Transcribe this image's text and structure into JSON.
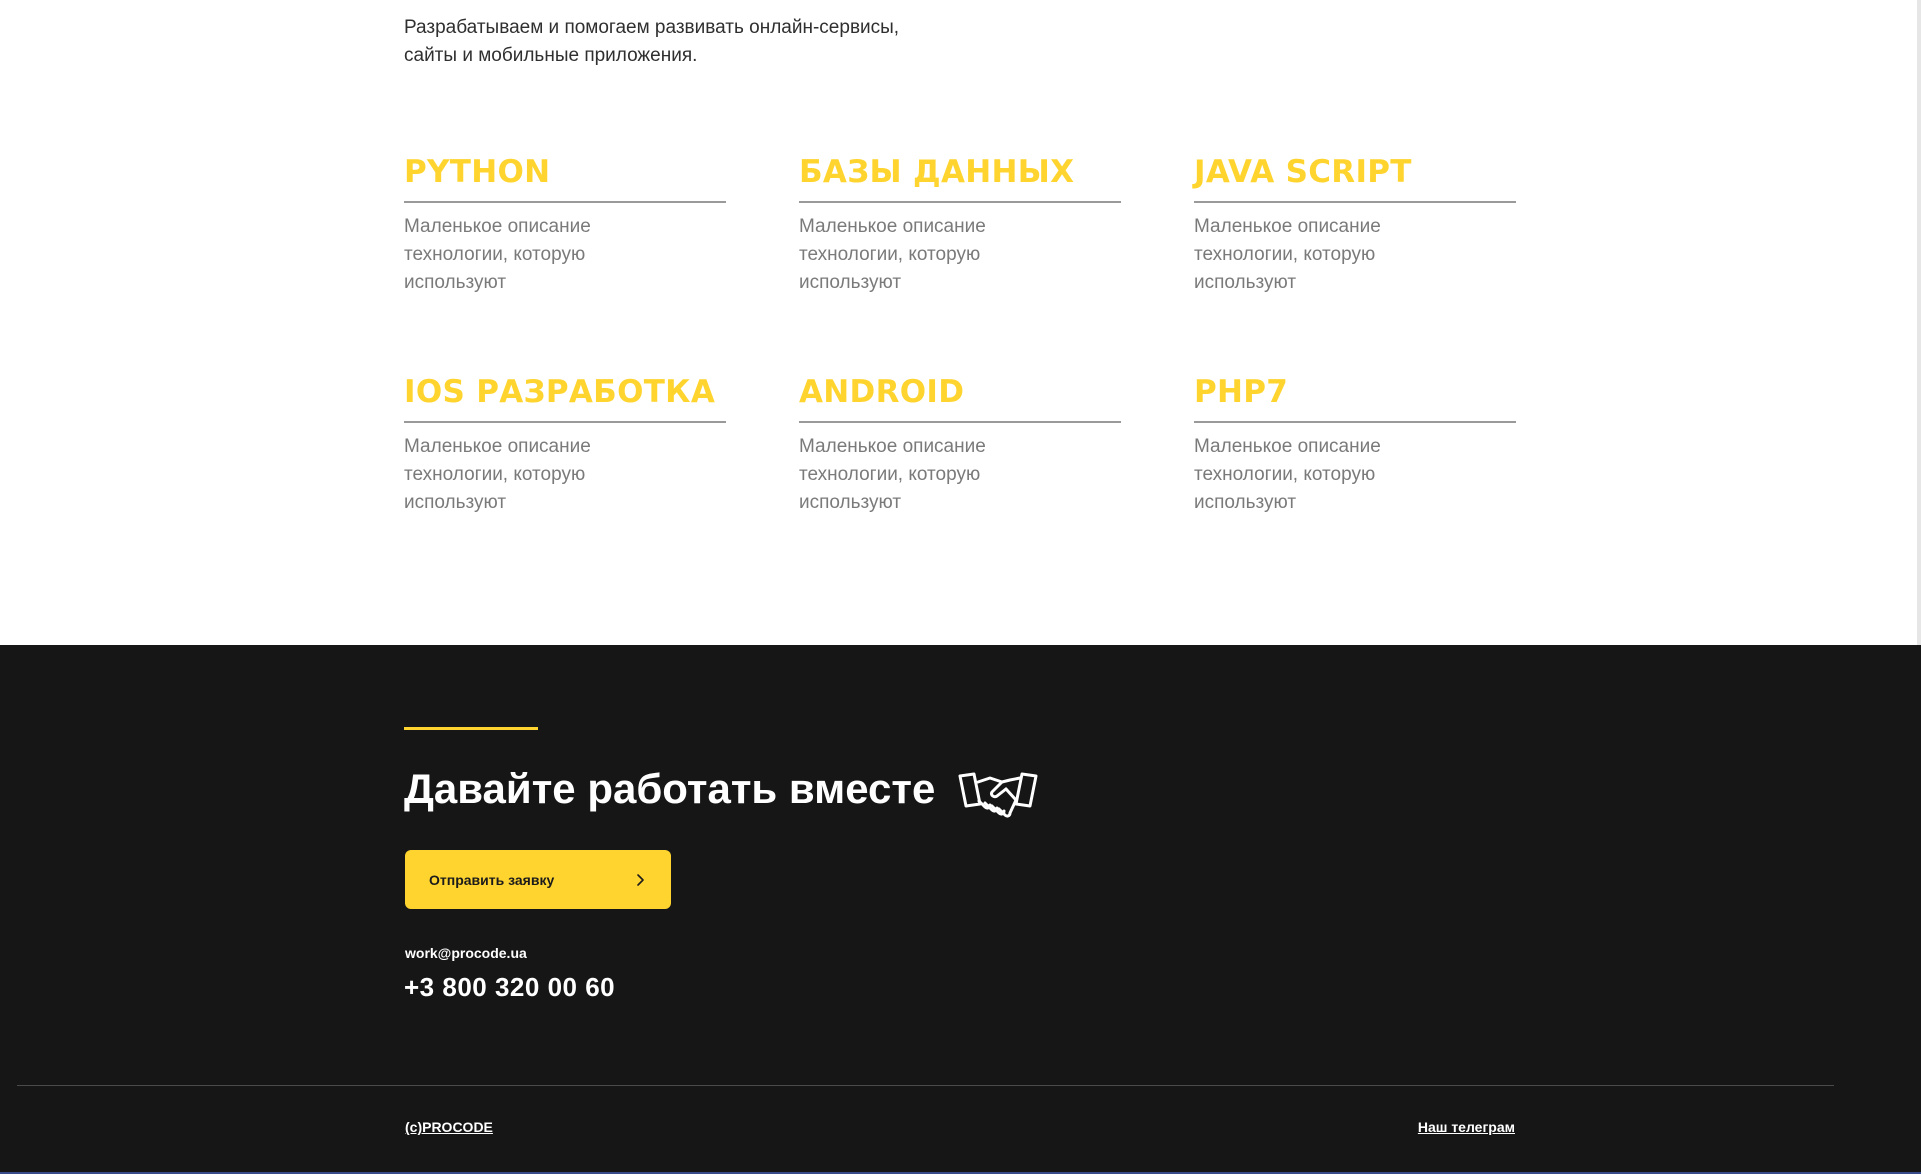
{
  "intro": {
    "line1": "Разрабатываем и помогаем развивать онлайн-сервисы,",
    "line2": "сайты и мобильные приложения."
  },
  "technologies": [
    {
      "title": "PYTHON",
      "description": "Маленькое описание технологии, которую используют"
    },
    {
      "title": "БАЗЫ ДАННЫХ",
      "description": "Маленькое описание технологии, которую используют"
    },
    {
      "title": "JAVA SCRIPT",
      "description": "Маленькое описание технологии, которую используют"
    },
    {
      "title": "IOS РАЗРАБОТКА",
      "description": "Маленькое описание технологии, которую используют"
    },
    {
      "title": "ANDROID",
      "description": "Маленькое описание технологии, которую используют"
    },
    {
      "title": "PHP7",
      "description": "Маленькое описание технологии, которую используют"
    }
  ],
  "footer": {
    "cta_title": "Давайте работать вместе",
    "cta_icon": "handshake-icon",
    "send_button_label": "Отправить заявку",
    "send_button_icon": "chevron-right-icon",
    "email": "work@procode.ua",
    "phone": "+3 800 320 00 60",
    "copyright": "(c)PROCODE",
    "telegram_link": "Наш телеграм"
  },
  "colors": {
    "accent": "#ffd42f",
    "footer_bg": "#161616",
    "text_dark": "#2f2f2f",
    "text_muted": "#7a7a7a"
  }
}
